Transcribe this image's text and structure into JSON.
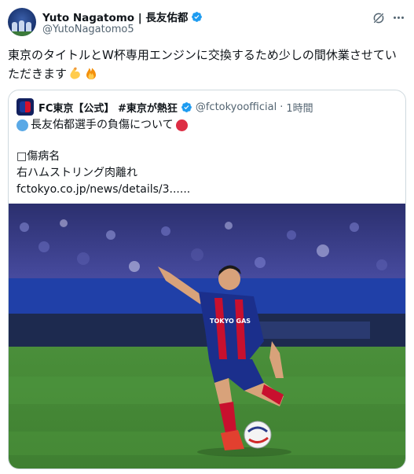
{
  "author": {
    "display_name": "Yuto Nagatomo | 長友佑都",
    "handle": "@YutoNagatomo5",
    "verified": true,
    "avatar_icon": "team-photo-avatar"
  },
  "actions": {
    "grok_icon": "grok-icon",
    "more_icon": "more-icon"
  },
  "tweet": {
    "text": "東京のタイトルとW杯専用エンジンに交換するため少しの間休業させていただきます",
    "emojis": [
      "flexed-biceps",
      "fire"
    ]
  },
  "quoted_tweet": {
    "display_name": "FC東京【公式】 #東京が熱狂",
    "verified": true,
    "handle": "@fctokyoofficial",
    "separator": "·",
    "time": "1時間",
    "title": "長友佑都選手の負傷について",
    "injury_label": "□傷病名",
    "injury_value": "右ハムストリング肉離れ",
    "link": "fctokyo.co.jp/news/details/3......",
    "photo": {
      "description_icon": "player-kicking-photo",
      "shirt_sponsor": "TOKYO GAS",
      "colors": {
        "home_blue": "#1b2f8c",
        "home_red": "#c8102e",
        "pitch": "#4a8f3a"
      }
    }
  },
  "colors": {
    "text": "#0f1419",
    "secondary": "#536471",
    "border": "#cfd9de",
    "verified": "#1d9bf0"
  }
}
